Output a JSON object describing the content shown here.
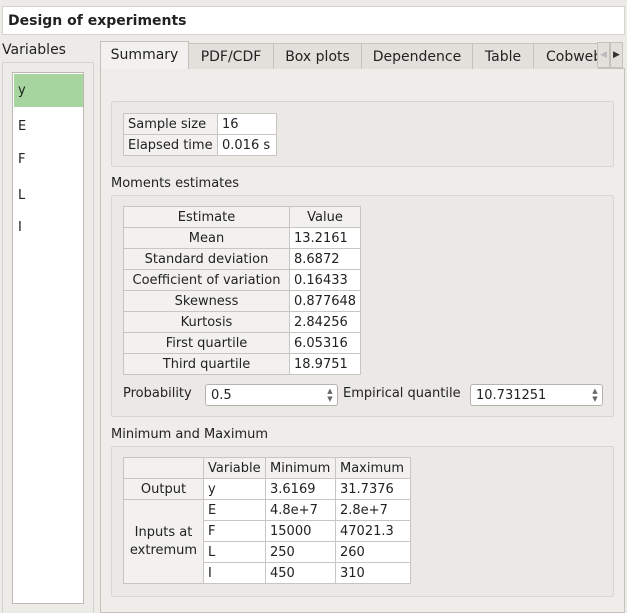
{
  "window": {
    "title": "Design of experiments"
  },
  "variables": {
    "label": "Variables",
    "items": [
      "y",
      "E",
      "F",
      "L",
      "I"
    ],
    "selected": "y",
    "selected_color": "#a6d5a0"
  },
  "tabs": [
    "Summary",
    "PDF/CDF",
    "Box plots",
    "Dependence",
    "Table",
    "Cobweb"
  ],
  "active_tab": "Summary",
  "summary": {
    "info": [
      {
        "label": "Sample size",
        "value": "16"
      },
      {
        "label": "Elapsed time",
        "value": "0.016 s"
      }
    ],
    "moments": {
      "title": "Moments estimates",
      "headers": [
        "Estimate",
        "Value"
      ],
      "rows": [
        [
          "Mean",
          "13.2161"
        ],
        [
          "Standard deviation",
          "8.6872"
        ],
        [
          "Coefficient of variation",
          "0.16433"
        ],
        [
          "Skewness",
          "0.877648"
        ],
        [
          "Kurtosis",
          "2.84256"
        ],
        [
          "First quartile",
          "6.05316"
        ],
        [
          "Third quartile",
          "18.9751"
        ]
      ]
    },
    "probability": {
      "label": "Probability",
      "value": "0.5"
    },
    "quantile": {
      "label": "Empirical quantile",
      "value": "10.731251"
    },
    "minmax": {
      "title": "Minimum and Maximum",
      "headers": [
        "",
        "Variable",
        "Minimum",
        "Maximum"
      ],
      "output_label": "Output",
      "inputs_label": "Inputs at extremum",
      "output_row": [
        "y",
        "3.6169",
        "31.7376"
      ],
      "input_rows": [
        [
          "E",
          "4.8e+7",
          "2.8e+7"
        ],
        [
          "F",
          "15000",
          "47021.3"
        ],
        [
          "L",
          "250",
          "260"
        ],
        [
          "I",
          "450",
          "310"
        ]
      ]
    }
  }
}
